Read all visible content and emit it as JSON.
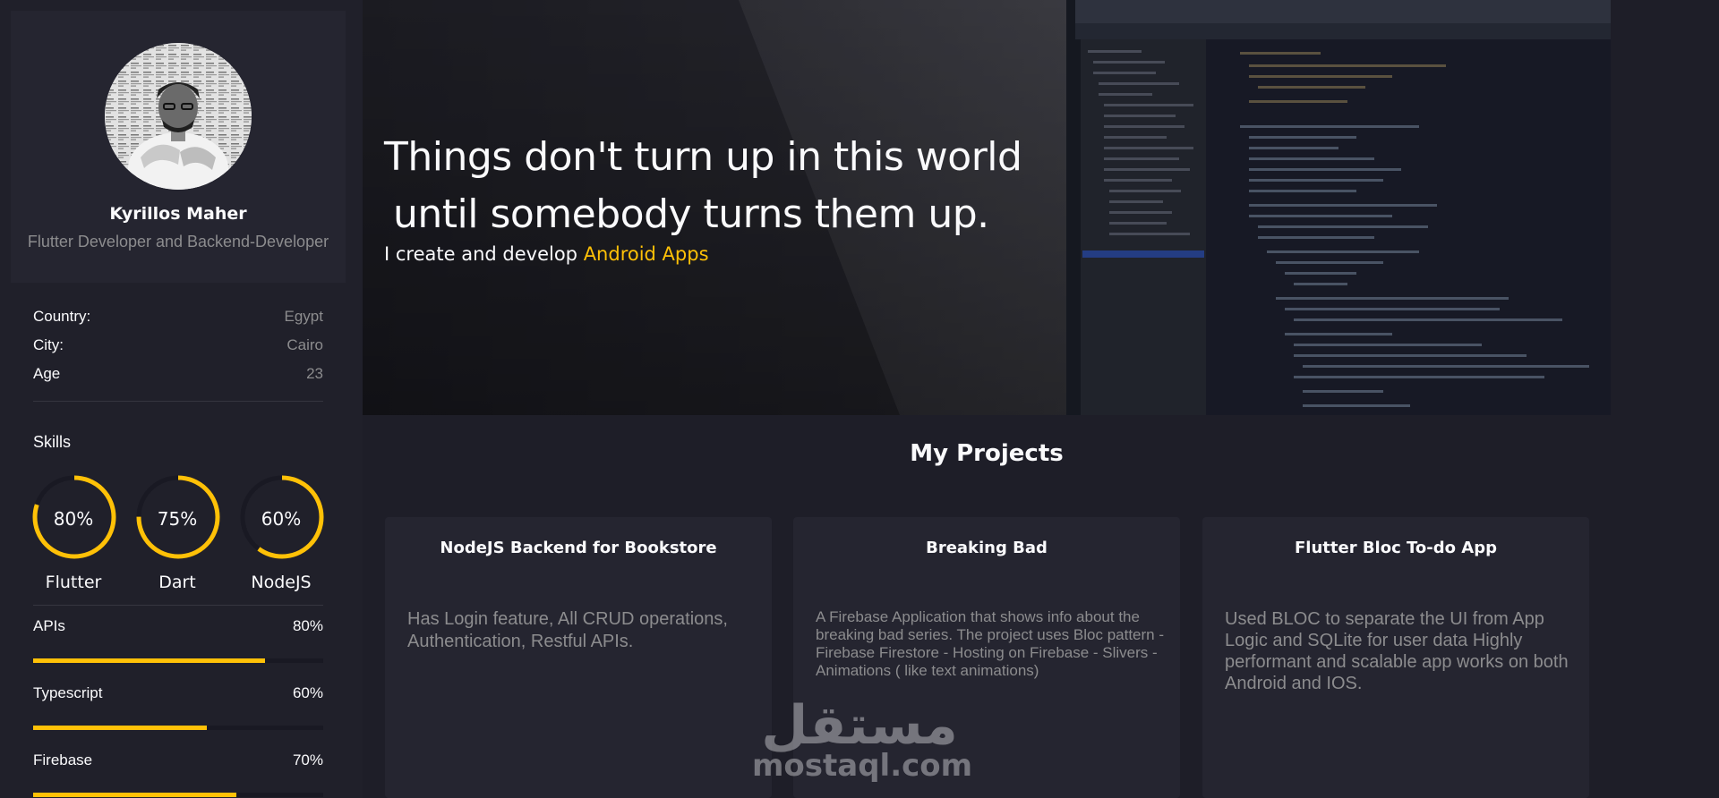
{
  "profile": {
    "name": "Kyrillos Maher",
    "role": "Flutter Developer and Backend-Developer"
  },
  "info": [
    {
      "label": "Country:",
      "value": "Egypt"
    },
    {
      "label": "City:",
      "value": "Cairo"
    },
    {
      "label": "Age",
      "value": "23"
    }
  ],
  "skills": {
    "title": "Skills",
    "circles": [
      {
        "name": "Flutter",
        "percent_label": "80%",
        "percent": 80
      },
      {
        "name": "Dart",
        "percent_label": "75%",
        "percent": 75
      },
      {
        "name": "NodeJS",
        "percent_label": "60%",
        "percent": 60
      }
    ],
    "bars": [
      {
        "name": "APIs",
        "percent_label": "80%",
        "percent": 80
      },
      {
        "name": "Typescript",
        "percent_label": "60%",
        "percent": 60
      },
      {
        "name": "Firebase",
        "percent_label": "70%",
        "percent": 70
      }
    ]
  },
  "hero": {
    "title_line1": "Things don't turn up in this world",
    "title_line2": "until somebody turns them up.",
    "subtitle_prefix": "I create and develop ",
    "subtitle_accent": "Android Apps"
  },
  "projects": {
    "title": "My Projects",
    "items": [
      {
        "title": "NodeJS Backend for Bookstore",
        "description": "Has Login feature, All CRUD operations, Authentication, Restful APIs."
      },
      {
        "title": "Breaking Bad",
        "description": "A Firebase Application that shows info about the breaking bad series. The project uses Bloc pattern - Firebase Firestore - Hosting on Firebase - Slivers - Animations ( like text animations)"
      },
      {
        "title": "Flutter Bloc To-do App",
        "description": "Used BLOC to separate the UI from App Logic and SQLite for user data Highly performant and scalable app works on both Android and IOS."
      }
    ]
  },
  "watermark": {
    "arabic": "مستقل",
    "latin": "mostaql.com"
  },
  "colors": {
    "accent": "#ffc107",
    "background": "#1e1e28",
    "card": "#252530",
    "muted_text": "#8c8c8e"
  }
}
